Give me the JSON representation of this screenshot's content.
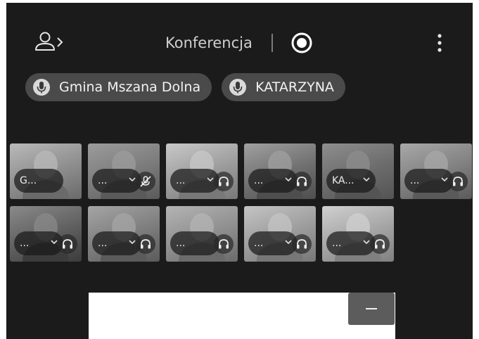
{
  "header": {
    "title": "Konferencja",
    "icons": {
      "participants": "user-chevron-icon",
      "record": "record-icon",
      "more": "more-vertical-icon"
    }
  },
  "chips": [
    {
      "label": "Gmina Mszana Dolna",
      "icon": "microphone-icon"
    },
    {
      "label": "KATARZYNA",
      "icon": "microphone-icon"
    }
  ],
  "tiles": [
    {
      "label": "G...",
      "chevron": false,
      "audio": "none",
      "tone": [
        "#8d8d8d",
        "#6a6a6a",
        "#b9b9b9"
      ]
    },
    {
      "label": "...",
      "chevron": true,
      "audio": "muted",
      "tone": [
        "#7a7a7a",
        "#5a5a5a",
        "#9c9c9c"
      ]
    },
    {
      "label": "...",
      "chevron": true,
      "audio": "headphones",
      "tone": [
        "#9b9b9b",
        "#787878",
        "#c8c8c8"
      ]
    },
    {
      "label": "...",
      "chevron": true,
      "audio": "headphones",
      "tone": [
        "#6f6f6f",
        "#4e4e4e",
        "#a0a0a0"
      ]
    },
    {
      "label": "KA...",
      "chevron": true,
      "audio": "none",
      "tone": [
        "#6b6b6b",
        "#545454",
        "#8e8e8e"
      ]
    },
    {
      "label": "...",
      "chevron": true,
      "audio": "headphones",
      "tone": [
        "#7f7f7f",
        "#5a5a5a",
        "#a8a8a8"
      ]
    },
    {
      "label": "...",
      "chevron": true,
      "audio": "headphones",
      "tone": [
        "#5e5e5e",
        "#3c3c3c",
        "#8a8a8a"
      ]
    },
    {
      "label": "...",
      "chevron": true,
      "audio": "headphones",
      "tone": [
        "#7c7c7c",
        "#5b5b5b",
        "#a5a5a5"
      ]
    },
    {
      "label": "...",
      "chevron": false,
      "audio": "headphones",
      "tone": [
        "#8e8e8e",
        "#6b6b6b",
        "#b4b4b4"
      ]
    },
    {
      "label": "...",
      "chevron": true,
      "audio": "headphones",
      "tone": [
        "#9a9a9a",
        "#777777",
        "#c4c4c4"
      ]
    },
    {
      "label": "...",
      "chevron": true,
      "audio": "headphones",
      "tone": [
        "#a3a3a3",
        "#808080",
        "#d0d0d0"
      ]
    }
  ],
  "colors": {
    "background": "#1b1b1b",
    "chip": "#4a4a4a",
    "text": "#f2f2f2",
    "panel": "#ffffff",
    "minimize": "#5c5c5c"
  }
}
